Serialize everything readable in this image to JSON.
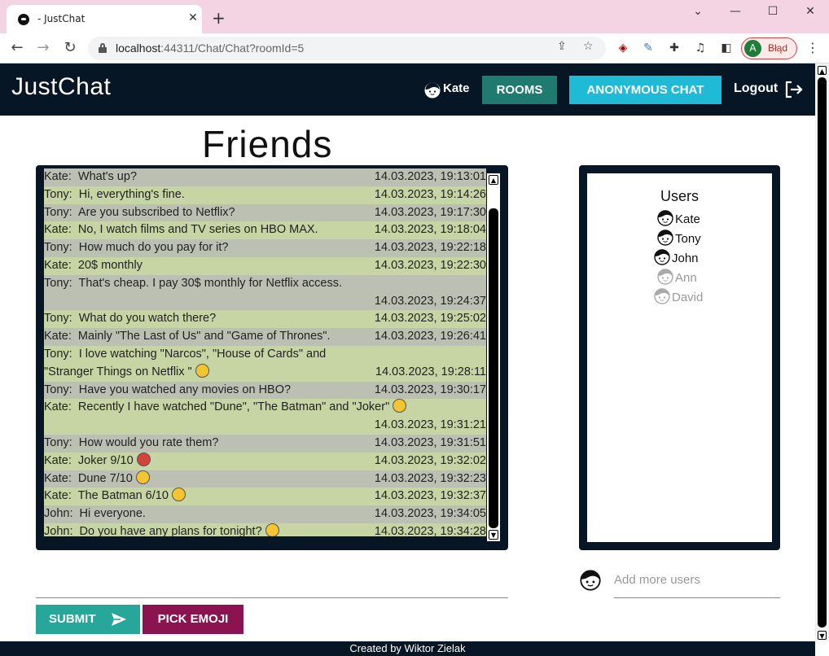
{
  "browser": {
    "tab_title": "- JustChat",
    "tab_close": "✕",
    "new_tab": "+",
    "url_host": "localhost",
    "url_path": ":44311/Chat/Chat?roomId=5",
    "profile_initial": "A",
    "profile_label": "Błąd",
    "window_controls": [
      "⌄",
      "—",
      "☐",
      "✕"
    ]
  },
  "navbar": {
    "brand": "JustChat",
    "current_user": "Kate",
    "rooms_label": "ROOMS",
    "anon_label": "ANONYMOUS CHAT",
    "logout_label": "Logout"
  },
  "room": {
    "title": "Friends"
  },
  "messages": [
    {
      "user": "Kate:",
      "text": "What's up?",
      "time": "14.03.2023, 19:13:01",
      "emoji": null
    },
    {
      "user": "Tony:",
      "text": "Hi, everything's fine.",
      "time": "14.03.2023, 19:14:26",
      "emoji": null
    },
    {
      "user": "Tony:",
      "text": "Are you subscribed to Netflix?",
      "time": "14.03.2023, 19:17:30",
      "emoji": null
    },
    {
      "user": "Kate:",
      "text": "No, I watch films and TV series on HBO MAX.",
      "time": "14.03.2023, 19:18:04",
      "emoji": null
    },
    {
      "user": "Tony:",
      "text": "How much do you pay for it?",
      "time": "14.03.2023, 19:22:18",
      "emoji": null
    },
    {
      "user": "Kate:",
      "text": "20$ monthly",
      "time": "14.03.2023, 19:22:30",
      "emoji": null
    },
    {
      "user": "Tony:",
      "text": "That's cheap. I pay 30$ monthly for Netflix access.",
      "time": "14.03.2023, 19:24:37",
      "emoji": null,
      "wrap": true
    },
    {
      "user": "Tony:",
      "text": "What do you watch there?",
      "time": "14.03.2023, 19:25:02",
      "emoji": null
    },
    {
      "user": "Kate:",
      "text": "Mainly \"The Last of Us\" and \"Game of Thrones\".",
      "time": "14.03.2023, 19:26:41",
      "emoji": null
    },
    {
      "user": "Tony:",
      "text": "I love watching \"Narcos\", \"House of Cards\" and \"Stranger Things on Netflix \"",
      "time": "14.03.2023, 19:28:11",
      "emoji": "grin"
    },
    {
      "user": "Tony:",
      "text": "Have you watched any movies on HBO?",
      "time": "14.03.2023, 19:30:17",
      "emoji": null
    },
    {
      "user": "Kate:",
      "text": "Recently I have watched \"Dune\", \"The Batman\" and \"Joker\"",
      "time": "14.03.2023, 19:31:21",
      "emoji": "smile",
      "wrap": true
    },
    {
      "user": "Tony:",
      "text": "How would you rate them?",
      "time": "14.03.2023, 19:31:51",
      "emoji": null
    },
    {
      "user": "Kate:",
      "text": "Joker 9/10",
      "time": "14.03.2023, 19:32:02",
      "emoji": "devil"
    },
    {
      "user": "Kate:",
      "text": "Dune 7/10",
      "time": "14.03.2023, 19:32:23",
      "emoji": "blush"
    },
    {
      "user": "Kate:",
      "text": "The Batman 6/10",
      "time": "14.03.2023, 19:32:37",
      "emoji": "wink"
    },
    {
      "user": "John:",
      "text": "Hi everyone.",
      "time": "14.03.2023, 19:34:05",
      "emoji": null
    },
    {
      "user": "John:",
      "text": "Do you have any plans for tonight?",
      "time": "14.03.2023, 19:34:28",
      "emoji": "sunglasses"
    }
  ],
  "users": {
    "title": "Users",
    "list": [
      {
        "name": "Kate",
        "online": true
      },
      {
        "name": "Tony",
        "online": true
      },
      {
        "name": "John",
        "online": true
      },
      {
        "name": "Ann",
        "online": false
      },
      {
        "name": "David",
        "online": false
      }
    ],
    "add_placeholder": "Add more users"
  },
  "composer": {
    "message_value": "",
    "submit_label": "SUBMIT",
    "emoji_label": "PICK EMOJI"
  },
  "footer": {
    "text": "Created by Wiktor Zielak"
  },
  "colors": {
    "navbar_bg": "#061624",
    "rooms_btn": "#1f7b6f",
    "anon_btn": "#1fbad6",
    "submit_btn": "#27a69a",
    "emoji_btn": "#8b1350",
    "msg_a": "#c6d5a3",
    "msg_b": "#bcc0b3"
  }
}
